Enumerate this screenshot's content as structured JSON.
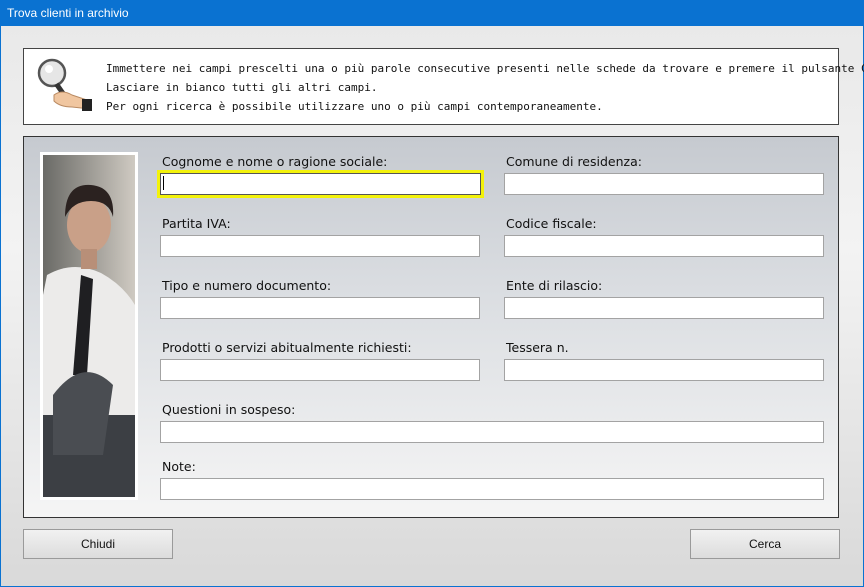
{
  "window": {
    "title": "Trova clienti in archivio"
  },
  "info": {
    "icon": "magnifier-icon",
    "lines": [
      "Immettere nei campi prescelti una o più parole consecutive presenti nelle schede da trovare e premere il pulsante Cerca.",
      "Lasciare in bianco tutti gli altri campi.",
      "Per ogni ricerca è possibile utilizzare uno o più campi contemporaneamente."
    ]
  },
  "form": {
    "cognome_nome": {
      "label": "Cognome e nome o ragione sociale:",
      "value": ""
    },
    "comune": {
      "label": "Comune di residenza:",
      "value": ""
    },
    "partita_iva": {
      "label": "Partita IVA:",
      "value": ""
    },
    "codice_fiscale": {
      "label": "Codice fiscale:",
      "value": ""
    },
    "documento": {
      "label": "Tipo e numero documento:",
      "value": ""
    },
    "ente": {
      "label": "Ente di rilascio:",
      "value": ""
    },
    "prodotti": {
      "label": "Prodotti o servizi abitualmente richiesti:",
      "value": ""
    },
    "tessera": {
      "label": "Tessera n.",
      "value": ""
    },
    "questioni": {
      "label": "Questioni in sospeso:",
      "value": ""
    },
    "note": {
      "label": "Note:",
      "value": ""
    }
  },
  "buttons": {
    "close": "Chiudi",
    "search": "Cerca"
  }
}
